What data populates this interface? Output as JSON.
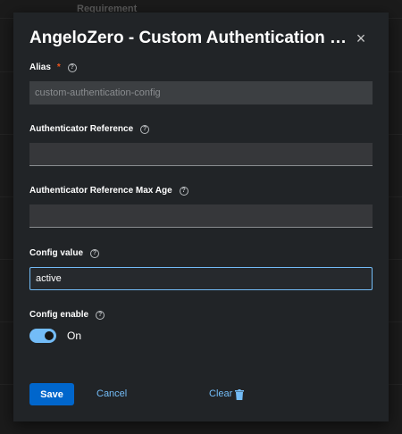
{
  "background": {
    "table_header": "Requirement"
  },
  "modal": {
    "title": "AngeloZero - Custom Authentication con...",
    "close_icon": "close-icon"
  },
  "fields": {
    "alias": {
      "label": "Alias",
      "required_mark": "*",
      "value": "custom-authentication-config"
    },
    "authenticator_reference": {
      "label": "Authenticator Reference",
      "value": ""
    },
    "authenticator_reference_max_age": {
      "label": "Authenticator Reference Max Age",
      "value": ""
    },
    "config_value": {
      "label": "Config value",
      "value": "active"
    },
    "config_enable": {
      "label": "Config enable",
      "state_label": "On",
      "checked": true
    }
  },
  "footer": {
    "save_label": "Save",
    "cancel_label": "Cancel",
    "clear_label": "Clear"
  },
  "colors": {
    "primary": "#0066cc",
    "link": "#73bcf7",
    "required": "#f0561d"
  }
}
